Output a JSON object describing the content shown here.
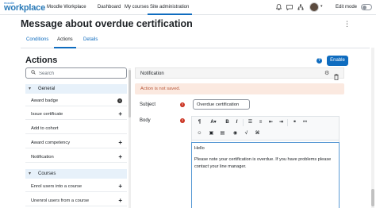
{
  "brand": {
    "small": "moodle",
    "big": "workplace"
  },
  "nav": {
    "items": [
      {
        "label": "Moodle Workplace"
      },
      {
        "label": "Dashboard"
      },
      {
        "label": "My courses"
      },
      {
        "label": "Site administration"
      }
    ],
    "active_item": "Site administration",
    "edit_mode_label": "Edit mode",
    "icons": [
      "bell-icon",
      "chat-icon",
      "org-icon",
      "grid-icon"
    ]
  },
  "page": {
    "title": "Message about overdue certification",
    "tabs": [
      {
        "label": "Conditions"
      },
      {
        "label": "Actions"
      },
      {
        "label": "Details"
      }
    ],
    "active_tab": "Actions"
  },
  "actions": {
    "title": "Actions",
    "enable_label": "Enable",
    "search_placeholder": "Search",
    "sections": [
      {
        "title": "General",
        "items": [
          {
            "label": "Award badge",
            "right": "info"
          },
          {
            "label": "Issue certificate",
            "right": "add"
          },
          {
            "label": "Add to cohort",
            "right": ""
          },
          {
            "label": "Award competency",
            "right": "add"
          },
          {
            "label": "Notification",
            "right": "add"
          }
        ]
      },
      {
        "title": "Courses",
        "items": [
          {
            "label": "Enrol users into a course",
            "right": "add"
          },
          {
            "label": "Unenrol users from a course",
            "right": "add"
          }
        ]
      }
    ]
  },
  "notification": {
    "header": "Notification",
    "warning": "Action is not saved.",
    "subject_label": "Subject",
    "subject_value": "Overdue certification",
    "body_label": "Body",
    "toolbar": [
      "paragraph-icon",
      "font-color-icon",
      "bold-icon",
      "italic-icon",
      "unordered-list-icon",
      "ordered-list-icon",
      "link-icon",
      "unlink-icon",
      "emoji-icon",
      "image-icon",
      "media-icon",
      "accessibility-icon",
      "equation-icon",
      "code-icon"
    ],
    "body_lines": [
      "Hello",
      "",
      "Please note your certification is overdue. If you have problems please",
      "contact your line manager."
    ]
  },
  "colors": {
    "primary": "#0f6cbf",
    "danger": "#ca3120",
    "warning_bg": "#fbe9e0",
    "section_bg": "#e7f1fa"
  }
}
